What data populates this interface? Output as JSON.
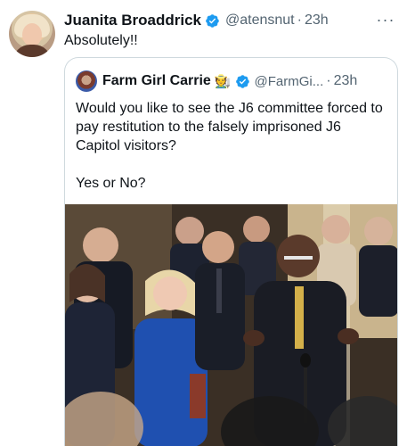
{
  "tweet": {
    "author_name": "Juanita Broaddrick",
    "author_handle": "@atensnut",
    "separator": "·",
    "timestamp": "23h",
    "more_icon": "···",
    "text": "Absolutely!!",
    "verified_icon": "verified-badge-icon"
  },
  "quoted_tweet": {
    "author_name": "Farm Girl Carrie",
    "emoji": "🧑‍🌾",
    "author_handle": "@FarmGi...",
    "separator": "·",
    "timestamp": "23h",
    "text": "Would you like to see the J6 committee forced to pay restitution to the falsely imprisoned J6 Capitol visitors?\n\nYes or No?"
  },
  "colors": {
    "verified_blue": "#1d9bf0",
    "secondary_text": "#536471",
    "border": "#cfd9de"
  }
}
